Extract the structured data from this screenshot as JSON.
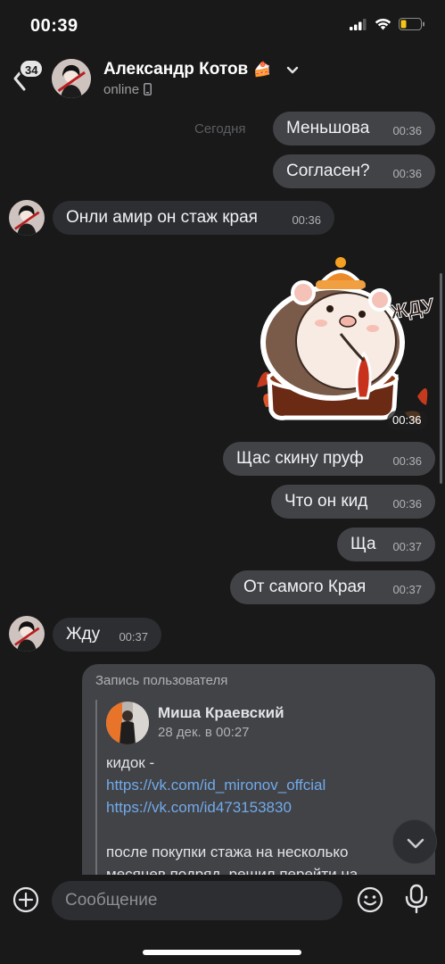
{
  "status_bar": {
    "time": "00:39"
  },
  "header": {
    "back_badge": "34",
    "contact_name": "Александр Котов",
    "contact_emoji": "🍰",
    "status": "online"
  },
  "date_label": "Сегодня",
  "messages": [
    {
      "text": "Меньшова",
      "time": "00:36",
      "direction": "out"
    },
    {
      "text": "Согласен?",
      "time": "00:36",
      "direction": "out"
    },
    {
      "text": "Онли амир он стаж края",
      "time": "00:36",
      "direction": "in"
    },
    {
      "type": "sticker",
      "sticker_text": "ЖДУ",
      "time": "00:36",
      "direction": "out"
    },
    {
      "text": "Щас скину пруф",
      "time": "00:36",
      "direction": "out"
    },
    {
      "text": "Что он кид",
      "time": "00:36",
      "direction": "out"
    },
    {
      "text": "Ща",
      "time": "00:37",
      "direction": "out"
    },
    {
      "text": "От самого Края",
      "time": "00:37",
      "direction": "out"
    },
    {
      "text": "Жду",
      "time": "00:37",
      "direction": "in"
    }
  ],
  "repost": {
    "title": "Запись пользователя",
    "author": "Миша Краевский",
    "date": "28 дек. в 00:27",
    "text_line1": "кидок -",
    "link1": "https://vk.com/id_mironov_offcial",
    "link2": "https://vk.com/id473153830",
    "text_line2": "после покупки стажа на несколько",
    "text_line3": "месяцев подряд, решил перейти на"
  },
  "input": {
    "placeholder": "Сообщение"
  },
  "colors": {
    "background": "#19191a",
    "bubble_out": "#424347",
    "bubble_in": "#2d2e31",
    "link": "#71aaeb"
  }
}
